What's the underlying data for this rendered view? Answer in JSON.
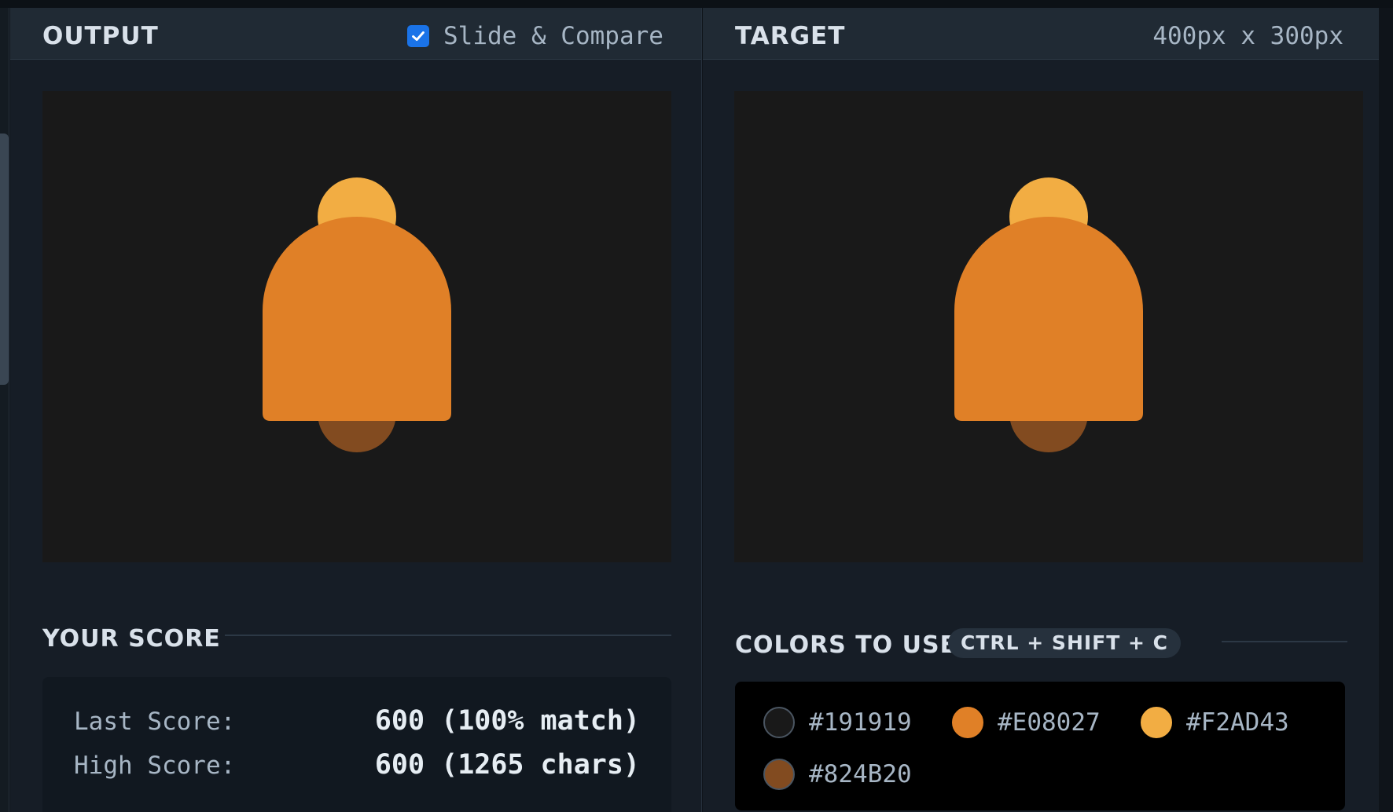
{
  "output_panel": {
    "title": "OUTPUT",
    "slide_compare_label": "Slide & Compare",
    "slide_compare_checked": true
  },
  "target_panel": {
    "title": "TARGET",
    "dimensions": "400px x 300px"
  },
  "score": {
    "title": "YOUR SCORE",
    "last_label": "Last Score:",
    "last_value": "600 (100% match)",
    "high_label": "High Score:",
    "high_value": "600 (1265 chars)"
  },
  "colors_section": {
    "title": "COLORS TO USE",
    "shortcut": "CTRL + SHIFT + C",
    "swatches": [
      {
        "hex": "#191919"
      },
      {
        "hex": "#E08027"
      },
      {
        "hex": "#F2AD43"
      },
      {
        "hex": "#824B20"
      }
    ]
  },
  "colors": {
    "background": "#191919",
    "bell_body": "#E08027",
    "bell_top": "#F2AD43",
    "bell_clapper": "#824B20",
    "checkbox_accent": "#1a73e8"
  }
}
